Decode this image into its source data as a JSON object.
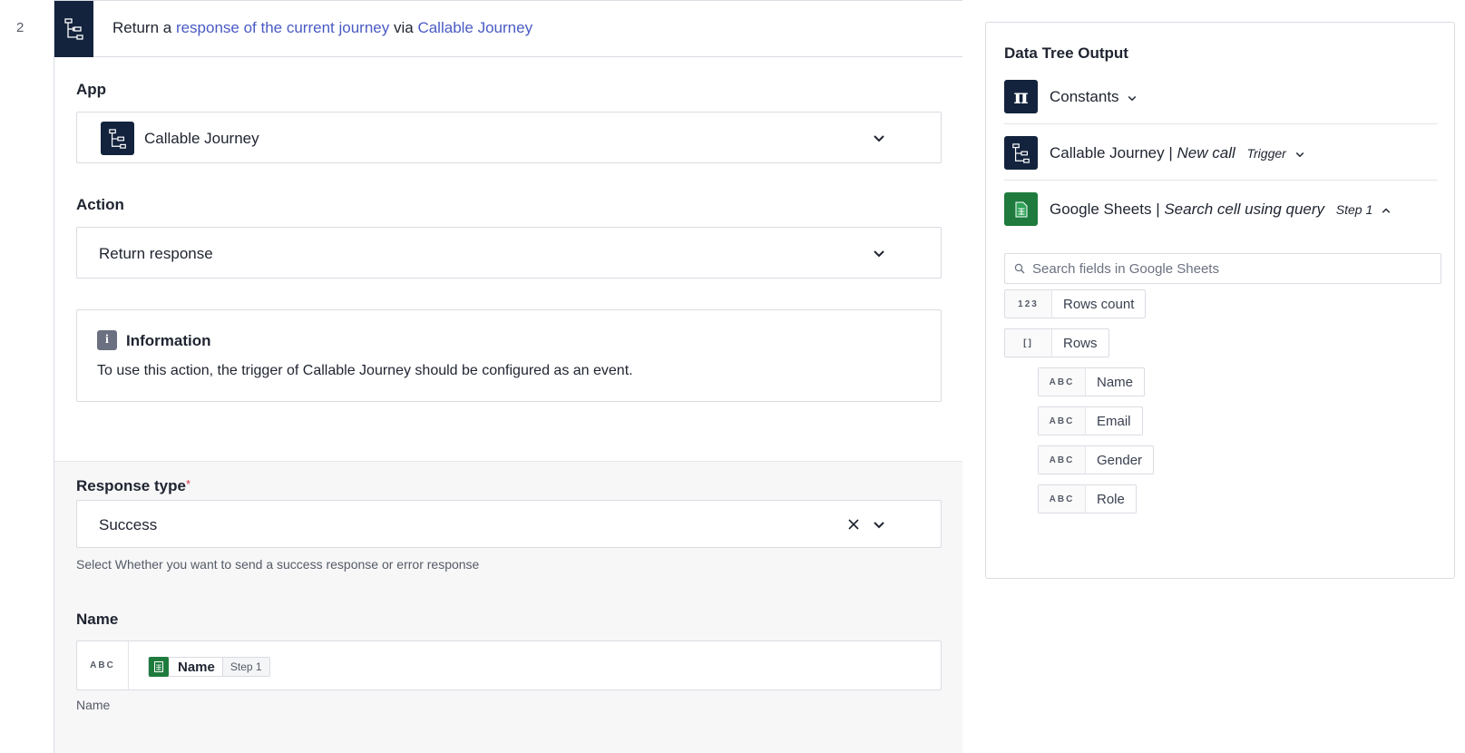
{
  "step": {
    "number": "2",
    "header": {
      "prefix": "Return a",
      "link1": "response of the current journey",
      "middle": "via",
      "link2": "Callable Journey"
    }
  },
  "app_field": {
    "label": "App",
    "icon": "callable-journey-icon",
    "value": "Callable Journey"
  },
  "action_field": {
    "label": "Action",
    "value": "Return response"
  },
  "info": {
    "title": "Information",
    "text": "To use this action, the trigger of Callable Journey should be configured as an event."
  },
  "response_type": {
    "label": "Response type",
    "required_mark": "*",
    "value": "Success",
    "helper": "Select Whether you want to send a success response or error response"
  },
  "name_field": {
    "label": "Name",
    "type_tag": "ABC",
    "pill_name": "Name",
    "pill_step": "Step 1",
    "helper": "Name"
  },
  "data_tree": {
    "title": "Data Tree Output",
    "items": [
      {
        "icon": "pi-icon",
        "app": "Constants",
        "italic": "",
        "tag": ""
      },
      {
        "icon": "callable-journey-icon",
        "app": "Callable Journey |",
        "italic": "New call",
        "tag": "Trigger"
      },
      {
        "icon": "google-sheets-icon",
        "app": "Google Sheets |",
        "italic": "Search cell using query",
        "tag": "Step 1"
      }
    ],
    "search_placeholder": "Search fields in Google Sheets",
    "fields": [
      {
        "type": "123",
        "label": "Rows count"
      },
      {
        "type": "[]",
        "label": "Rows"
      },
      {
        "type": "ABC",
        "label": "Name"
      },
      {
        "type": "ABC",
        "label": "Email"
      },
      {
        "type": "ABC",
        "label": "Gender"
      },
      {
        "type": "ABC",
        "label": "Role"
      }
    ]
  },
  "colors": {
    "accent_link": "#4a5bc4",
    "app_dark": "#13233d",
    "sheets_green": "#1e7b3d",
    "required": "#d6324a"
  }
}
